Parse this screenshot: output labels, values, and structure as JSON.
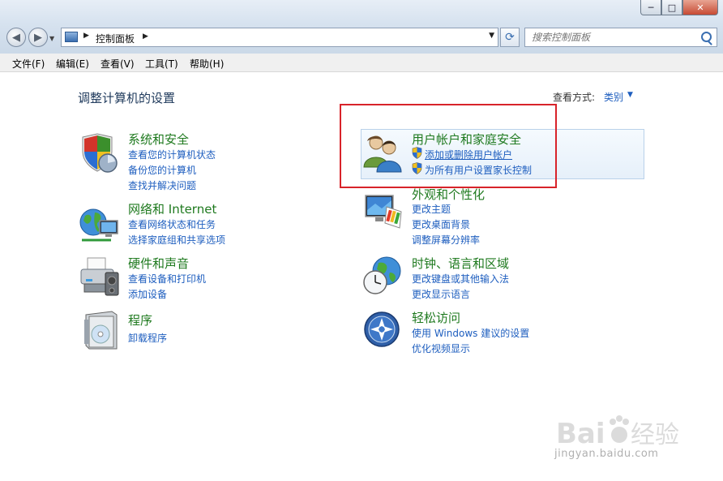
{
  "window": {
    "minimize": "─",
    "maximize": "□",
    "close": "✕"
  },
  "address": {
    "crumb": "控制面板",
    "search_placeholder": "搜索控制面板"
  },
  "menu": [
    "文件(F)",
    "编辑(E)",
    "查看(V)",
    "工具(T)",
    "帮助(H)"
  ],
  "main": {
    "heading": "调整计算机的设置",
    "view_by_label": "查看方式:",
    "view_by_value": "类别"
  },
  "categories": [
    {
      "title": "系统和安全",
      "links": [
        "查看您的计算机状态",
        "备份您的计算机",
        "查找并解决问题"
      ]
    },
    {
      "title": "网络和 Internet",
      "links": [
        "查看网络状态和任务",
        "选择家庭组和共享选项"
      ]
    },
    {
      "title": "硬件和声音",
      "links": [
        "查看设备和打印机",
        "添加设备"
      ]
    },
    {
      "title": "程序",
      "links": [
        "卸载程序"
      ]
    },
    {
      "title": "用户帐户和家庭安全",
      "links": [
        "添加或删除用户帐户",
        "为所有用户设置家长控制"
      ]
    },
    {
      "title": "外观和个性化",
      "links": [
        "更改主题",
        "更改桌面背景",
        "调整屏幕分辨率"
      ]
    },
    {
      "title": "时钟、语言和区域",
      "links": [
        "更改键盘或其他输入法",
        "更改显示语言"
      ]
    },
    {
      "title": "轻松访问",
      "links": [
        "使用 Windows 建议的设置",
        "优化视频显示"
      ]
    }
  ],
  "watermark": {
    "text": "jingyan.baidu.com"
  },
  "colors": {
    "link": "#1e5ebf",
    "category_title": "#1f7a1f",
    "highlight_box": "#d8232a"
  }
}
